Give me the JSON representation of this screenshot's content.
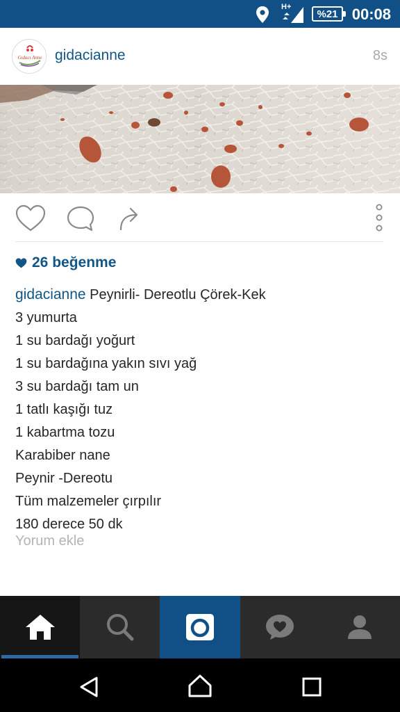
{
  "status_bar": {
    "time": "00:08",
    "battery": "%21",
    "network": "H+",
    "background_color": "#115087",
    "icons": [
      "location-icon",
      "signal-icon",
      "battery-icon"
    ]
  },
  "post": {
    "username": "gidacianne",
    "time_ago": "8s",
    "avatar_text": "Gıdacı Anne",
    "likes": "26 beğenme",
    "caption_title": "Peynirli- Dereotlu Çörek-Kek",
    "caption_lines": [
      "3 yumurta",
      "1 su bardağı yoğurt",
      "1 su bardağına yakın sıvı yağ",
      "3 su bardağı tam un",
      "1 tatlı kaşığı tuz",
      "1 kabartma tozu",
      "Karabiber nane",
      "Peynir -Dereotu",
      "Tüm malzemeler çırpılır",
      "180 derece 50 dk"
    ],
    "add_comment": "Yorum ekle",
    "accent_color": "#125688"
  },
  "actions": [
    "heart-icon",
    "comment-icon",
    "share-icon",
    "more-icon"
  ],
  "tabbar": {
    "tabs": [
      "home",
      "search",
      "camera",
      "activity",
      "profile"
    ],
    "active": "home",
    "camera_color": "#115087"
  },
  "navbar": [
    "back",
    "home",
    "recents"
  ]
}
